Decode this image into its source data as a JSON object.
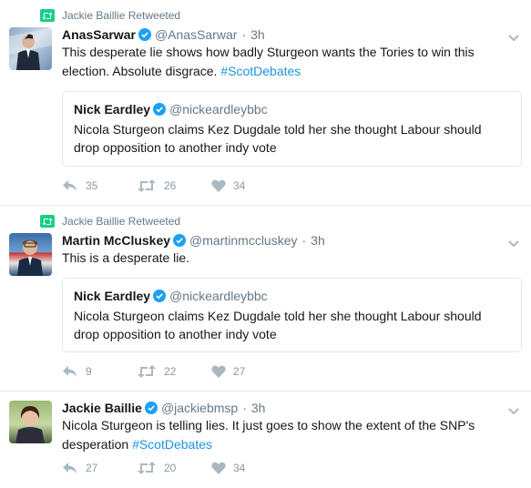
{
  "tweets": [
    {
      "retweet_label": "Jackie Baillie Retweeted",
      "name": "AnasSarwar",
      "handle": "@AnasSarwar",
      "separator": "·",
      "time": "3h",
      "text": "This desperate lie shows how badly Sturgeon wants the Tories to win this election. Absolute disgrace. ",
      "hashtag": "#ScotDebates",
      "quote": {
        "name": "Nick Eardley",
        "handle": "@nickeardleybbc",
        "text": "Nicola Sturgeon claims Kez Dugdale told her she thought Labour should drop opposition to another indy vote"
      },
      "replies": "35",
      "retweets": "26",
      "likes": "34"
    },
    {
      "retweet_label": "Jackie Baillie Retweeted",
      "name": "Martin McCluskey",
      "handle": "@martinmccluskey",
      "separator": "·",
      "time": "3h",
      "text": "This is a desperate lie.",
      "quote": {
        "name": "Nick Eardley",
        "handle": "@nickeardleybbc",
        "text": "Nicola Sturgeon claims Kez Dugdale told her she thought Labour should drop opposition to another indy vote"
      },
      "replies": "9",
      "retweets": "22",
      "likes": "27"
    },
    {
      "name": "Jackie Baillie",
      "handle": "@jackiebmsp",
      "separator": "·",
      "time": "3h",
      "text": "Nicola Sturgeon is telling lies. It just goes to show the extent of the SNP's desperation ",
      "hashtag": "#ScotDebates",
      "replies": "27",
      "retweets": "20",
      "likes": "34"
    }
  ],
  "colors": {
    "verified": "#1da1f2",
    "retweet_green": "#19cf86",
    "link": "#1b95e0",
    "muted": "#657786"
  }
}
